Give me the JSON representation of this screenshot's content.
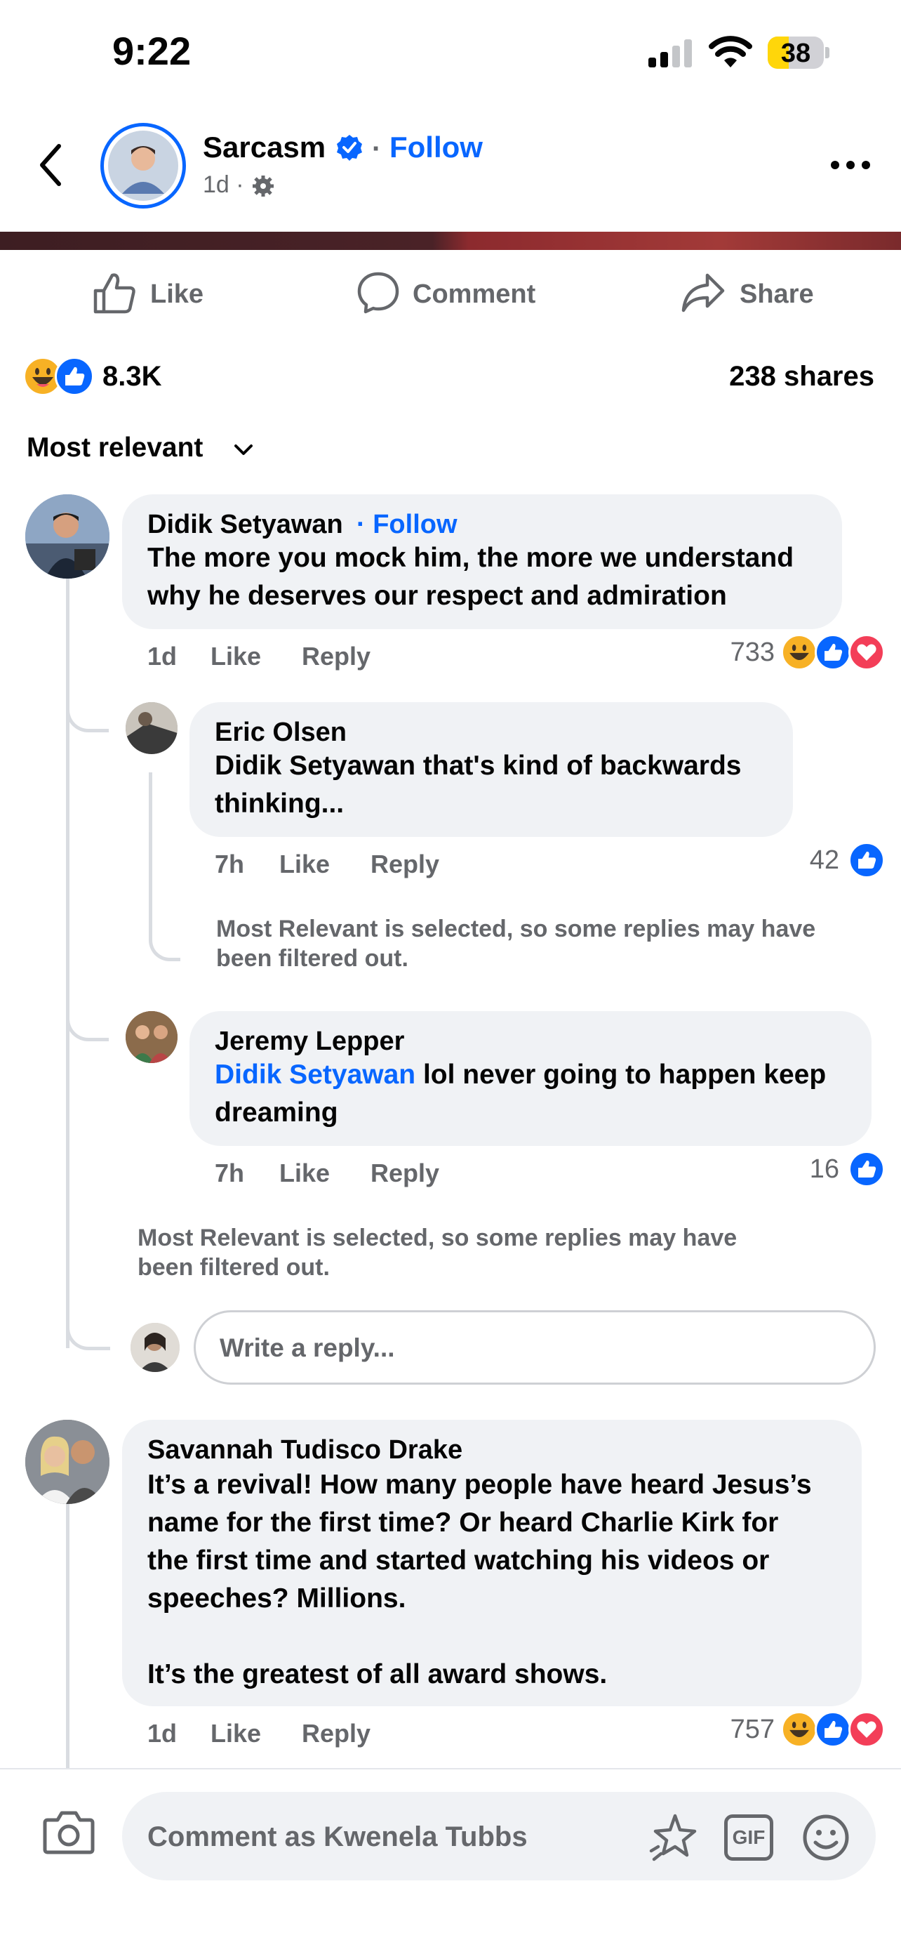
{
  "status": {
    "time": "9:22",
    "battery": "38"
  },
  "header": {
    "page_name": "Sarcasm",
    "follow": "Follow",
    "dot": "·",
    "time": "1d ·"
  },
  "actions": {
    "like": "Like",
    "comment": "Comment",
    "share": "Share"
  },
  "stats": {
    "reactions": "8.3K",
    "shares": "238 shares"
  },
  "sort": {
    "label": "Most relevant"
  },
  "comments": [
    {
      "name": "Didik Setyawan",
      "follow": "· Follow",
      "line1": "The more you mock him, the more we understand",
      "line2": "why he deserves our respect and admiration",
      "time": "1d",
      "like": "Like",
      "reply": "Reply",
      "count": "733",
      "replies": [
        {
          "name": "Eric Olsen",
          "line1": "Didik Setyawan that's kind of backwards",
          "line2": "thinking...",
          "time": "7h",
          "like": "Like",
          "reply": "Reply",
          "count": "42",
          "note1": "Most Relevant is selected, so some replies may have",
          "note2": "been filtered out."
        },
        {
          "name": "Jeremy Lepper",
          "mention": "Didik Setyawan",
          "line1_rest": " lol never going to happen keep",
          "line2": "dreaming",
          "time": "7h",
          "like": "Like",
          "reply": "Reply",
          "count": "16"
        }
      ],
      "note1": "Most Relevant is selected, so some replies may have",
      "note2": "been filtered out.",
      "reply_placeholder": "Write a reply..."
    },
    {
      "name": "Savannah Tudisco Drake",
      "line1": "It’s a revival! How many people have heard Jesus’s",
      "line2": "name for the first time? Or heard Charlie Kirk for",
      "line3": "the first time and started watching his videos or",
      "line4": "speeches? Millions.",
      "line5": "It’s the greatest of all award shows.",
      "time": "1d",
      "like": "Like",
      "reply": "Reply",
      "count": "757"
    }
  ],
  "composer": {
    "placeholder": "Comment as Kwenela Tubbs",
    "gif": "GIF"
  },
  "colors": {
    "accent": "#0866ff",
    "bubble": "#f0f2f5",
    "love": "#f33e58",
    "haha": "#f7b125"
  }
}
